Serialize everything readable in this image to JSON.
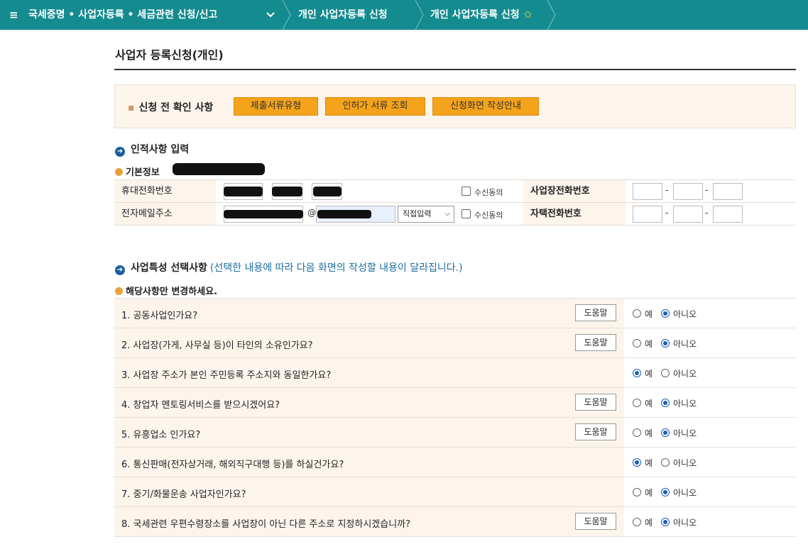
{
  "topbar": {
    "menu_icon": "≡",
    "crumb1": "국세증명 • 사업자등록 • 세금관련 신청/신고",
    "crumb2": "개인 사업자등록 신청",
    "crumb3": "개인 사업자등록 신청",
    "star": "✩",
    "colors": {
      "bar": "#138b8f",
      "star": "#f6d84a"
    }
  },
  "page": {
    "title": "사업자 등록신청(개인)"
  },
  "precheck": {
    "label": "신청 전 확인 사항",
    "buttons": [
      "제출서류유형",
      "인허가 서류 조회",
      "신청화면 작성안내"
    ],
    "button_color": "#f5a31a"
  },
  "section1": {
    "title": "인적사항 입력",
    "subtitle": "기본정보"
  },
  "info": {
    "mobile_label": "휴대전화번호",
    "email_label": "전자메일주소",
    "consent_label": "수신동의",
    "email_select": "직접입력",
    "email_at": "@",
    "dash": "-",
    "biz_phone_label": "사업장전화번호",
    "home_phone_label": "자택전화번호"
  },
  "section2": {
    "title": "사업특성 선택사항",
    "note": "(선택한 내용에 따라 다음 화면의 작성할 내용이 달라집니다.)",
    "subtitle": "해당사항만 변경하세요."
  },
  "questions": {
    "help_label": "도움말",
    "yes_label": "예",
    "no_label": "아니오",
    "items": [
      {
        "text": "1. 공동사업인가요?",
        "answer": "no"
      },
      {
        "text": "2. 사업장(가게, 사무실 등)이 타인의 소유인가요?",
        "answer": "no"
      },
      {
        "text": "3. 사업장 주소가 본인 주민등록 주소지와 동일한가요?",
        "answer": "yes"
      },
      {
        "text": "4. 창업자 멘토링서비스를 받으시겠어요?",
        "answer": "no"
      },
      {
        "text": "5. 유흥업소 인가요?",
        "answer": "no"
      },
      {
        "text": "6. 통신판매(전자상거래, 해외직구대행 등)를 하실건가요?",
        "answer": "yes"
      },
      {
        "text": "7. 중기/화물운송 사업자인가요?",
        "answer": "no"
      },
      {
        "text": "8. 국세관련 우편수령장소를 사업장이 아닌 다른 주소로 지정하시겠습니까?",
        "answer": "no"
      }
    ]
  }
}
